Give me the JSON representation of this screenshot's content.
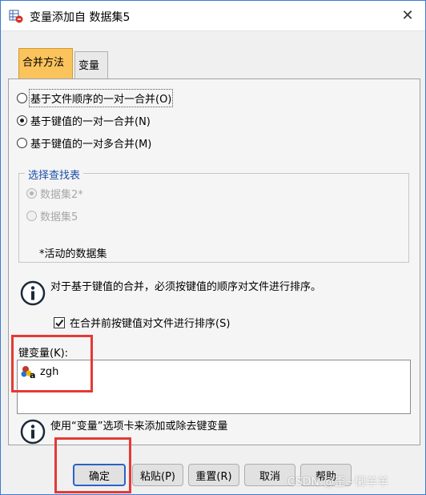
{
  "window": {
    "title": "变量添加自 数据集5",
    "close": "✕"
  },
  "tabs": [
    {
      "label": "合并方法",
      "active": true
    },
    {
      "label": "变量",
      "active": false
    }
  ],
  "merge_method": {
    "options": [
      {
        "label": "基于文件顺序的一对一合并(O)",
        "checked": false
      },
      {
        "label": "基于键值的一对一合并(N)",
        "checked": true
      },
      {
        "label": "基于键值的一对多合并(M)",
        "checked": false
      }
    ]
  },
  "lookup_table": {
    "title": "选择查找表",
    "options": [
      {
        "label": "数据集2*",
        "checked": true,
        "enabled": false
      },
      {
        "label": "数据集5",
        "checked": false,
        "enabled": false
      }
    ],
    "note": "*活动的数据集"
  },
  "info_sort": "对于基于键值的合并，必须按键值的顺序对文件进行排序。",
  "sort_checkbox": {
    "label": "在合并前按键值对文件进行排序(S)",
    "checked": true
  },
  "key_variables": {
    "label": "键变量(K):",
    "items": [
      "zgh"
    ]
  },
  "info_tab": "使用“变量”选项卡来添加或除去键变量",
  "buttons": {
    "ok": "确定",
    "paste": "粘贴(P)",
    "reset": "重置(R)",
    "cancel": "取消",
    "help": "帮助"
  },
  "watermark": "CSDN @歪~懒羊羊",
  "colors": {
    "active_tab": "#fbc35c",
    "highlight": "#e53935",
    "default_button_border": "#2a62c9"
  }
}
